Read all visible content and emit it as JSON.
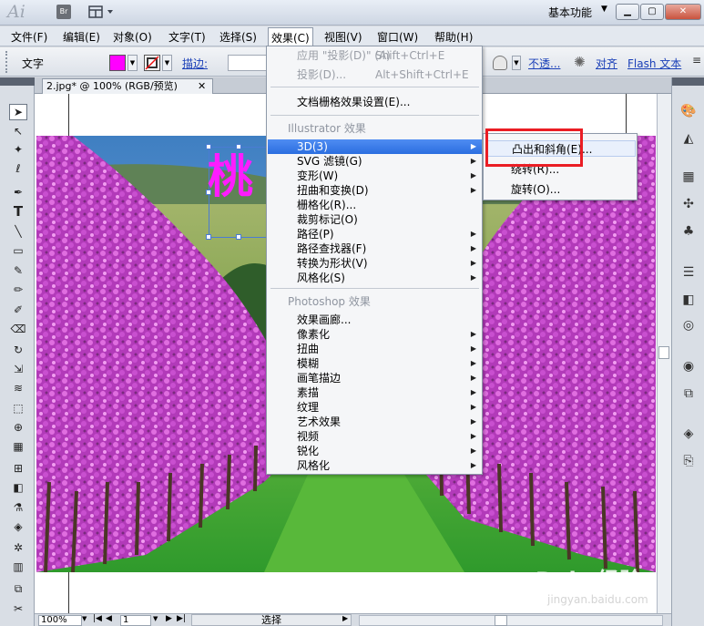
{
  "app": {
    "logo": "Ai",
    "bridge_label": "Br",
    "workspace": "基本功能"
  },
  "window_buttons": {
    "minimize": "▁",
    "restore": "▢",
    "close": "✕"
  },
  "menubar": [
    {
      "label": "文件(F)"
    },
    {
      "label": "编辑(E)"
    },
    {
      "label": "对象(O)"
    },
    {
      "label": "文字(T)"
    },
    {
      "label": "选择(S)"
    },
    {
      "label": "效果(C)"
    },
    {
      "label": "视图(V)"
    },
    {
      "label": "窗口(W)"
    },
    {
      "label": "帮助(H)"
    }
  ],
  "controlbar": {
    "type_label": "文字",
    "fill_color": "#ff00ff",
    "stroke_label": "描边:",
    "opacity_label": "不透...",
    "align_label": "对齐",
    "flash_label": "Flash 文本"
  },
  "document": {
    "tab_title": "2.jpg* @ 100% (RGB/预览)",
    "tab_close": "✕",
    "text_content": "桃"
  },
  "effect_menu": {
    "items": [
      {
        "label": "应用 \"投影(D)\" (A)",
        "shortcut": "Shift+Ctrl+E",
        "disabled": true
      },
      {
        "label": "投影(D)...",
        "shortcut": "Alt+Shift+Ctrl+E",
        "disabled": true
      },
      {
        "label": "文档栅格效果设置(E)..."
      },
      {
        "label": "Illustrator 效果",
        "header": true
      },
      {
        "label": "3D(3)",
        "highlighted": true
      },
      {
        "label": "SVG 滤镜(G)"
      },
      {
        "label": "变形(W)"
      },
      {
        "label": "扭曲和变换(D)"
      },
      {
        "label": "栅格化(R)..."
      },
      {
        "label": "裁剪标记(O)"
      },
      {
        "label": "路径(P)"
      },
      {
        "label": "路径查找器(F)"
      },
      {
        "label": "转换为形状(V)"
      },
      {
        "label": "风格化(S)"
      },
      {
        "label": "Photoshop 效果",
        "header": true
      },
      {
        "label": "效果画廊..."
      },
      {
        "label": "像素化"
      },
      {
        "label": "扭曲"
      },
      {
        "label": "模糊"
      },
      {
        "label": "画笔描边"
      },
      {
        "label": "素描"
      },
      {
        "label": "纹理"
      },
      {
        "label": "艺术效果"
      },
      {
        "label": "视频"
      },
      {
        "label": "锐化"
      },
      {
        "label": "风格化"
      }
    ]
  },
  "submenu_3d": {
    "items": [
      {
        "label": "凸出和斜角(E)..."
      },
      {
        "label": "绕转(R)..."
      },
      {
        "label": "旋转(O)..."
      }
    ]
  },
  "statusbar": {
    "zoom": "100%",
    "page": "1",
    "tool": "选择"
  },
  "watermark": {
    "logo": "Bai◎经验",
    "url": "jingyan.baidu.com"
  },
  "colors": {
    "highlight": "#2b6ee0",
    "annotation_box": "#ea1d24",
    "text_color": "#ff1cff"
  }
}
